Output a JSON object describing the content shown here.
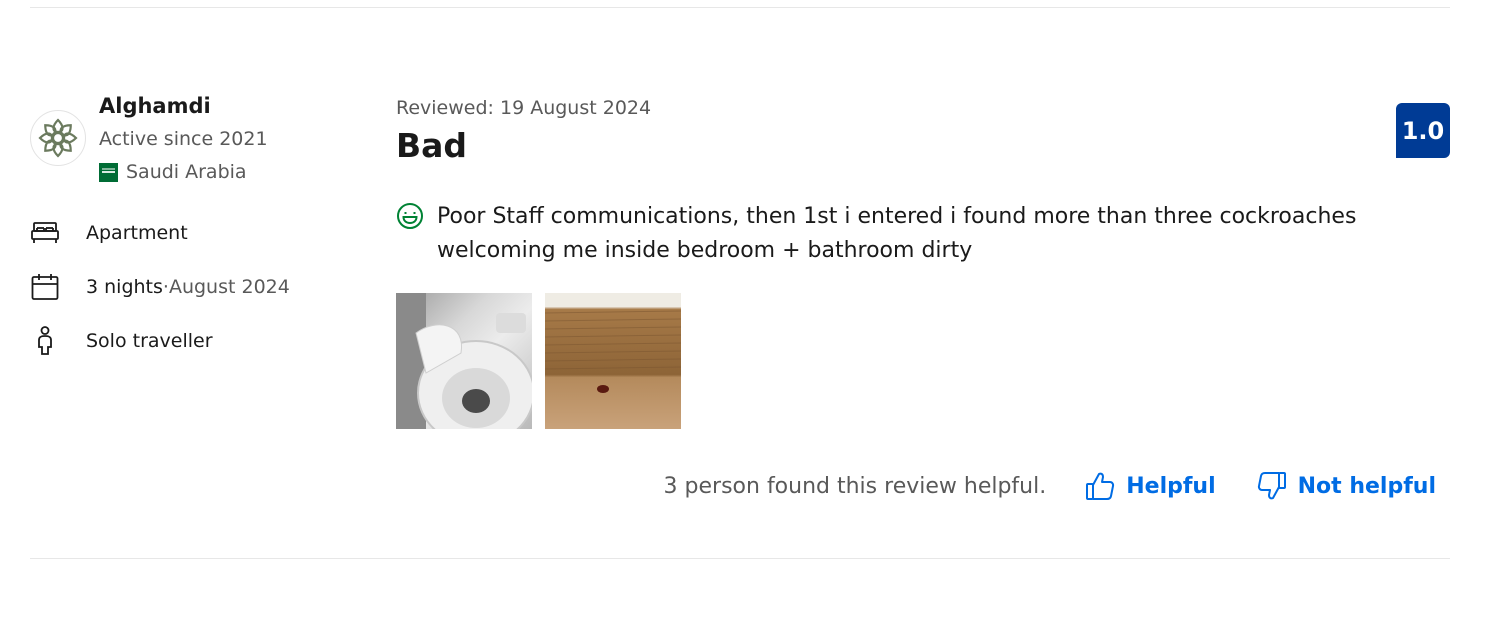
{
  "reviewer": {
    "name": "Alghamdi",
    "active_since": "Active since 2021",
    "country": "Saudi Arabia"
  },
  "stay": {
    "room_type": "Apartment",
    "nights": "3 nights",
    "separator": " · ",
    "month": "August 2024",
    "traveller_type": "Solo traveller"
  },
  "review": {
    "reviewed_date": "Reviewed: 19 August 2024",
    "title": "Bad",
    "score": "1.0",
    "positive_text": "Poor Staff communications, then 1st i entered i found more than three cockroaches welcoming me inside bedroom + bathroom dirty"
  },
  "photos": [
    {
      "name": "review-photo-toilet"
    },
    {
      "name": "review-photo-cockroach"
    }
  ],
  "feedback": {
    "helpful_count_text": "3 person found this review helpful.",
    "helpful_label": "Helpful",
    "not_helpful_label": "Not helpful"
  },
  "colors": {
    "score_badge": "#003b95",
    "link": "#006ce4",
    "positive_icon": "#008234",
    "muted_text": "#595959"
  },
  "icons": {
    "room": "bed-icon",
    "stay": "calendar-icon",
    "traveller": "person-icon",
    "positive": "smiley-icon",
    "helpful": "thumbs-up-icon",
    "not_helpful": "thumbs-down-icon"
  }
}
